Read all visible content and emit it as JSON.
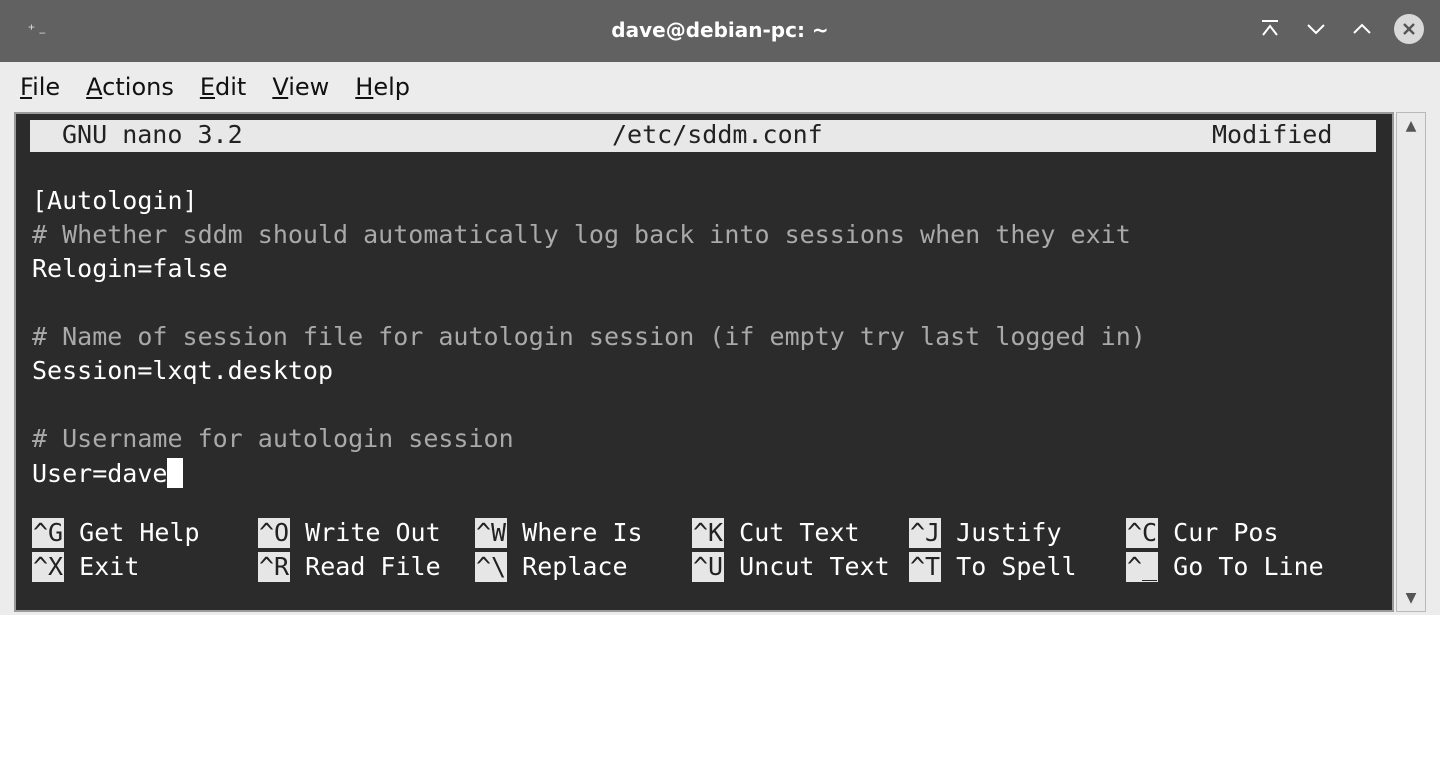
{
  "window": {
    "title": "dave@debian-pc: ~",
    "left_icon": "⁺₋"
  },
  "menubar": {
    "items": [
      {
        "mnemonic": "F",
        "rest": "ile"
      },
      {
        "mnemonic": "A",
        "rest": "ctions"
      },
      {
        "mnemonic": "E",
        "rest": "dit"
      },
      {
        "mnemonic": "V",
        "rest": "iew"
      },
      {
        "mnemonic": "H",
        "rest": "elp"
      }
    ]
  },
  "nano": {
    "version": "GNU nano 3.2",
    "filename": "/etc/sddm.conf",
    "status": "Modified",
    "lines": [
      {
        "text": "[Autologin]",
        "comment": false
      },
      {
        "text": "# Whether sddm should automatically log back into sessions when they exit",
        "comment": true
      },
      {
        "text": "Relogin=false",
        "comment": false
      },
      {
        "text": "",
        "comment": false
      },
      {
        "text": "# Name of session file for autologin session (if empty try last logged in)",
        "comment": true
      },
      {
        "text": "Session=lxqt.desktop",
        "comment": false
      },
      {
        "text": "",
        "comment": false
      },
      {
        "text": "# Username for autologin session",
        "comment": true
      },
      {
        "text": "User=dave",
        "comment": false
      }
    ],
    "shortcuts_row1": [
      {
        "key": "^G",
        "label": "Get Help"
      },
      {
        "key": "^O",
        "label": "Write Out"
      },
      {
        "key": "^W",
        "label": "Where Is"
      },
      {
        "key": "^K",
        "label": "Cut Text"
      },
      {
        "key": "^J",
        "label": "Justify"
      },
      {
        "key": "^C",
        "label": "Cur Pos"
      }
    ],
    "shortcuts_row2": [
      {
        "key": "^X",
        "label": "Exit"
      },
      {
        "key": "^R",
        "label": "Read File"
      },
      {
        "key": "^\\",
        "label": "Replace"
      },
      {
        "key": "^U",
        "label": "Uncut Text"
      },
      {
        "key": "^T",
        "label": "To Spell"
      },
      {
        "key": "^_",
        "label": "Go To Line"
      }
    ]
  },
  "icons": {
    "minimize": "chevron-down-icon",
    "maximize": "chevron-up-icon",
    "keep_above": "keep-above-icon",
    "close": "close-icon"
  }
}
